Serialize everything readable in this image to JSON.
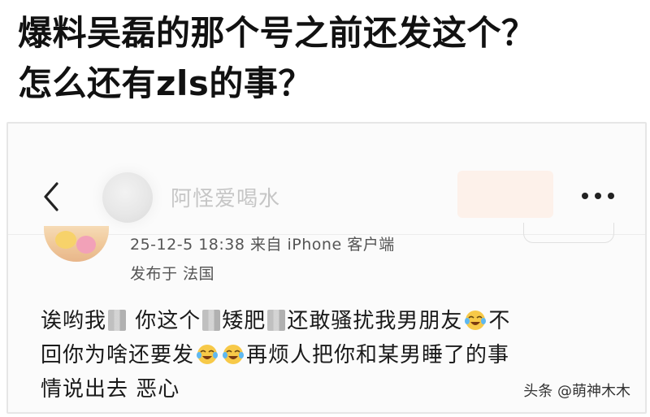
{
  "headline": {
    "line1": "爆料吴磊的那个号之前还发这个？",
    "line2": "怎么还有zls的事？"
  },
  "profile": {
    "username": "阿怪爱喝水"
  },
  "post": {
    "meta": "25-12-5 18:38  来自 iPhone 客户端",
    "location": "发布于  法国",
    "line1_a": "诶哟我",
    "line1_b": "你这个",
    "line1_c": "矮肥",
    "line1_d": "还敢骚扰我男朋友",
    "line1_e": "不",
    "line2_a": "回你为啥还要发",
    "line2_b": "再烦人把你和某男睡了的事",
    "line3": "情说出去  恶心"
  },
  "watermark": {
    "text": "头条 @萌神木木"
  },
  "icons": {
    "back": "chevron-left-icon",
    "more": "more-horizontal-icon",
    "emoji": "laughing-crying-emoji-icon"
  },
  "colors": {
    "text": "#111111",
    "muted": "#c6c6c6",
    "follow_button": "#fdeee6"
  }
}
